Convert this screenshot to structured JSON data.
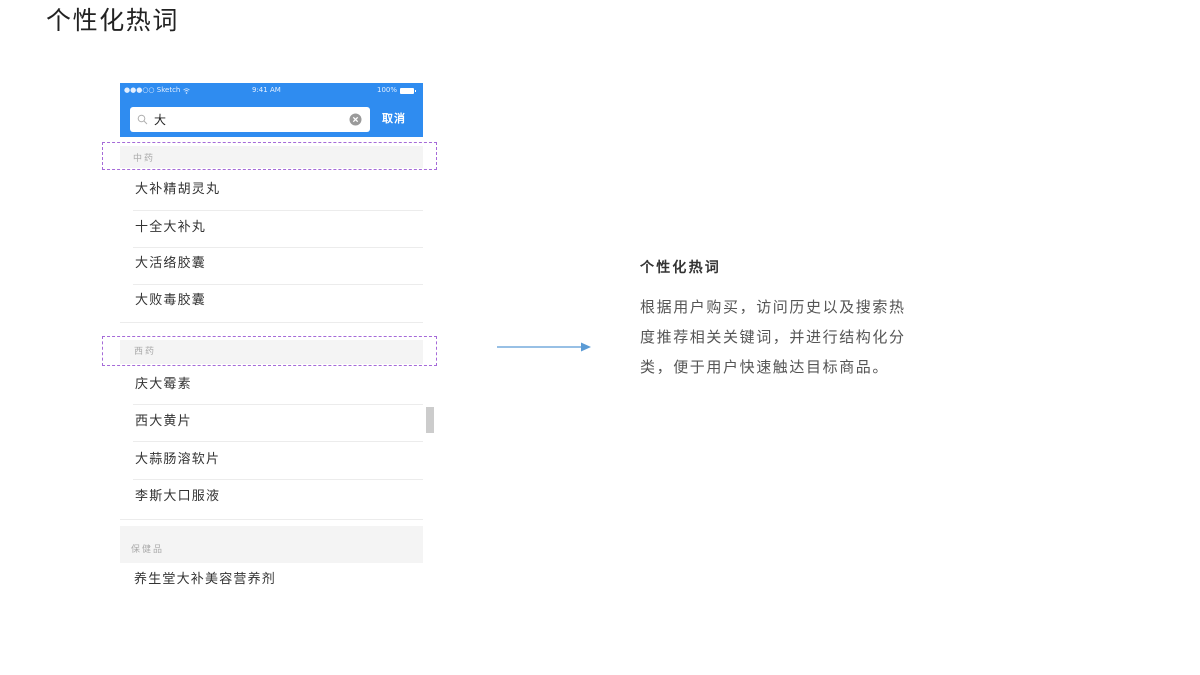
{
  "page": {
    "title": "个性化热词"
  },
  "phone": {
    "status_bar": {
      "carrier": "●●●○○ Sketch",
      "time": "9:41 AM",
      "battery": "100%"
    },
    "search": {
      "value": "大",
      "cancel_label": "取消"
    },
    "sections": [
      {
        "header": "中药",
        "items": [
          "大补精胡灵丸",
          "十全大补丸",
          "大活络胶囊",
          "大败毒胶囊"
        ]
      },
      {
        "header": "西药",
        "items": [
          "庆大霉素",
          "西大黄片",
          "大蒜肠溶软片",
          "李斯大口服液"
        ]
      },
      {
        "header": "保健品",
        "items": [
          "养生堂大补美容营养剂"
        ]
      }
    ]
  },
  "description": {
    "heading": "个性化热词",
    "lines": [
      "根据用户购买，访问历史以及搜索热",
      "度推荐相关关键词，并进行结构化分",
      "类，便于用户快速触达目标商品。"
    ]
  },
  "colors": {
    "accent": "#2f8cf0",
    "highlight": "#a56ad8",
    "arrow": "#5b9bd5",
    "section_bg": "#f4f4f4"
  },
  "icons": {
    "search": "search-icon",
    "clear": "clear-icon",
    "wifi": "wifi-icon",
    "battery": "battery-icon",
    "arrow": "arrow-right-icon"
  }
}
